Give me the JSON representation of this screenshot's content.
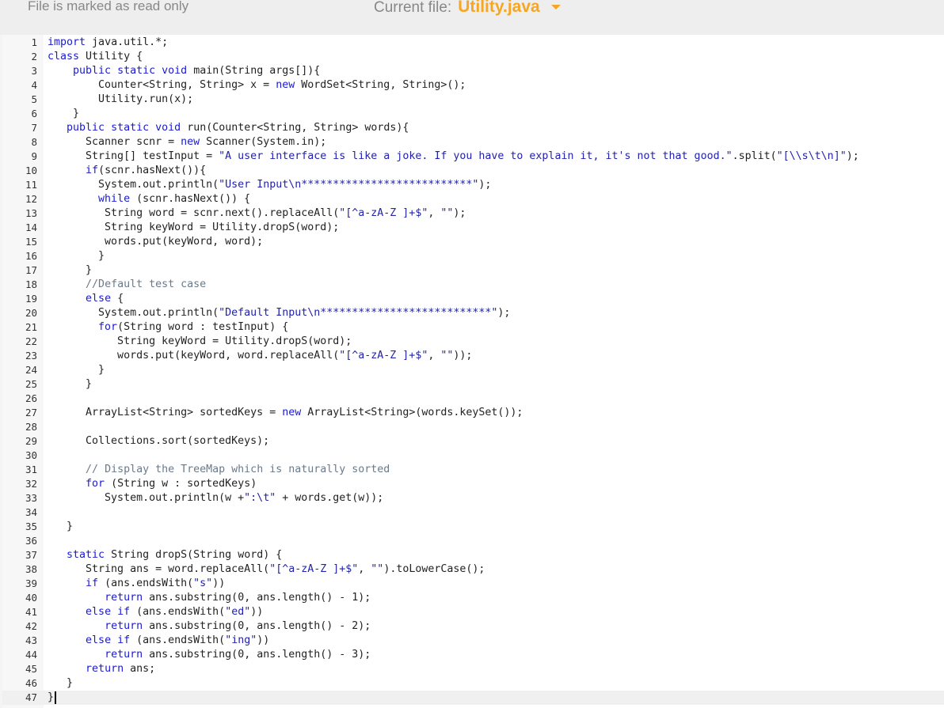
{
  "header": {
    "readonly_text": "File is marked as read only",
    "current_label": "Current file:",
    "current_file": "Utility.java",
    "dropdown_icon": "caret-down-icon",
    "accent_color": "#f5a623"
  },
  "editor": {
    "language": "java",
    "lines": [
      "import java.util.*;",
      "class Utility {",
      "    public static void main(String args[]){",
      "        Counter<String, String> x = new WordSet<String, String>();",
      "        Utility.run(x);",
      "    }",
      "   public static void run(Counter<String, String> words){",
      "      Scanner scnr = new Scanner(System.in);",
      "      String[] testInput = \"A user interface is like a joke. If you have to explain it, it's not that good.\".split(\"[\\\\s\\t\\n]\");",
      "      if(scnr.hasNext()){",
      "        System.out.println(\"User Input\\n***************************\");",
      "        while (scnr.hasNext()) {",
      "         String word = scnr.next().replaceAll(\"[^a-zA-Z ]+$\", \"\");",
      "         String keyWord = Utility.dropS(word);",
      "         words.put(keyWord, word);",
      "        }",
      "      }",
      "      //Default test case",
      "      else {",
      "        System.out.println(\"Default Input\\n***************************\");",
      "        for(String word : testInput) {",
      "           String keyWord = Utility.dropS(word);",
      "           words.put(keyWord, word.replaceAll(\"[^a-zA-Z ]+$\", \"\"));",
      "        }",
      "      }",
      "",
      "      ArrayList<String> sortedKeys = new ArrayList<String>(words.keySet());",
      "",
      "      Collections.sort(sortedKeys);",
      "",
      "      // Display the TreeMap which is naturally sorted",
      "      for (String w : sortedKeys)",
      "         System.out.println(w +\":\\t\" + words.get(w));",
      "",
      "   }",
      "",
      "   static String dropS(String word) {",
      "      String ans = word.replaceAll(\"[^a-zA-Z ]+$\", \"\").toLowerCase();",
      "      if (ans.endsWith(\"s\"))",
      "         return ans.substring(0, ans.length() - 1);",
      "      else if (ans.endsWith(\"ed\"))",
      "         return ans.substring(0, ans.length() - 2);",
      "      else if (ans.endsWith(\"ing\"))",
      "         return ans.substring(0, ans.length() - 3);",
      "      return ans;",
      "   }",
      "}"
    ]
  }
}
